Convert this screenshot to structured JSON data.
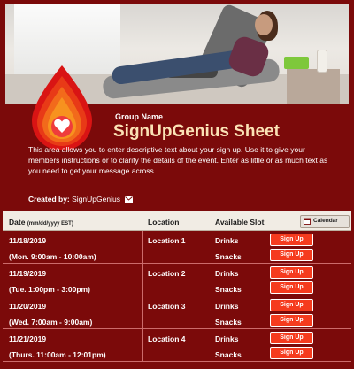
{
  "group_name": "Group Name",
  "sheet_title": "SignUpGenius Sheet",
  "description": "This area allows you to enter descriptive text about your sign up. Use it to give your members instructions or to clarify the details of the event. Enter as little or as much text as you need to get your message across.",
  "created_by_label": "Created by:",
  "created_by_name": "SignUpGenius",
  "icons": {
    "mail": "mail-icon",
    "calendar": "calendar-icon",
    "logo": "blood-drop-heart-icon"
  },
  "colors": {
    "background": "#7b0a0a",
    "title": "#fbe2b5",
    "button": "#f53b1e",
    "header": "#f1ece4"
  },
  "table": {
    "headers": {
      "date": "Date",
      "date_format": "(mm/dd/yyyy EST)",
      "location": "Location",
      "slot": "Available Slot",
      "calendar_button": "Calendar"
    },
    "signup_label": "Sign Up",
    "rows": [
      {
        "date": "11/18/2019",
        "time": "(Mon. 9:00am - 10:00am)",
        "location": "Location 1",
        "slots": [
          "Drinks",
          "Snacks"
        ]
      },
      {
        "date": "11/19/2019",
        "time": "(Tue. 1:00pm - 3:00pm)",
        "location": "Location 2",
        "slots": [
          "Drinks",
          "Snacks"
        ]
      },
      {
        "date": "11/20/2019",
        "time": "(Wed. 7:00am - 9:00am)",
        "location": "Location 3",
        "slots": [
          "Drinks",
          "Snacks"
        ]
      },
      {
        "date": "11/21/2019",
        "time": "(Thurs. 11:00am - 12:01pm)",
        "location": "Location 4",
        "slots": [
          "Drinks",
          "Snacks"
        ]
      }
    ]
  }
}
